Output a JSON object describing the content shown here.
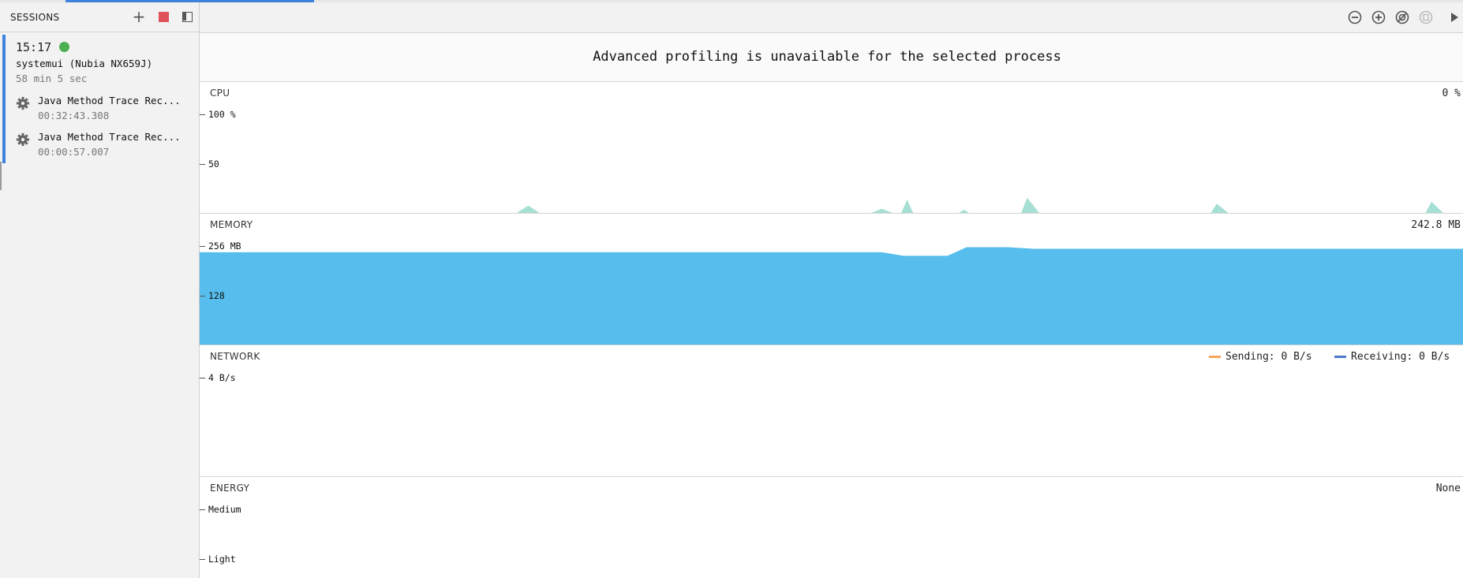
{
  "progress": {
    "fraction": 0.17
  },
  "sessions": {
    "title": "SESSIONS",
    "session": {
      "time": "15:17",
      "status_color": "#4caf50",
      "process": "systemui (Nubia NX659J)",
      "duration": "58 min 5 sec"
    },
    "traces": [
      {
        "name": "Java Method Trace Rec...",
        "time": "00:32:43.308",
        "icon": "gear-icon"
      },
      {
        "name": "Java Method Trace Rec...",
        "time": "00:00:57.007",
        "icon": "gear-icon"
      }
    ]
  },
  "toolbar": {
    "icons": [
      "zoom-out-icon",
      "zoom-in-icon",
      "reset-zoom-icon",
      "attach-to-live-icon",
      "go-live-icon"
    ]
  },
  "banner": {
    "text": "Advanced profiling is unavailable for the selected process"
  },
  "monitors": {
    "cpu": {
      "title": "CPU",
      "value": "0 %",
      "axis": [
        "100 %",
        "50"
      ],
      "color": "#a6dfd3"
    },
    "memory": {
      "title": "MEMORY",
      "value": "242.8 MB",
      "axis": [
        "256 MB",
        "128"
      ],
      "color": "#56bdec"
    },
    "network": {
      "title": "NETWORK",
      "axis": [
        "4 B/s"
      ],
      "sending": "Sending: 0 B/s",
      "receiving": "Receiving: 0 B/s",
      "sending_color": "#f7a35c",
      "receiving_color": "#4f78c8"
    },
    "energy": {
      "title": "ENERGY",
      "value": "None",
      "axis": [
        "Medium",
        "Light"
      ]
    }
  },
  "chart_data": [
    {
      "type": "area",
      "title": "CPU",
      "ylabel": "%",
      "ylim": [
        0,
        100
      ],
      "x": [
        0.25,
        0.26,
        0.27,
        0.53,
        0.54,
        0.55,
        0.555,
        0.56,
        0.565,
        0.57,
        0.6,
        0.605,
        0.61,
        0.65,
        0.655,
        0.665,
        0.8,
        0.805,
        0.815,
        0.97,
        0.975,
        0.985
      ],
      "values": [
        0,
        8,
        0,
        0,
        5,
        0,
        0,
        14,
        0,
        0,
        0,
        4,
        0,
        0,
        16,
        0,
        0,
        10,
        0,
        0,
        12,
        0
      ]
    },
    {
      "type": "area",
      "title": "MEMORY",
      "ylabel": "MB",
      "ylim": [
        0,
        256
      ],
      "x": [
        0,
        0.54,
        0.557,
        0.592,
        0.607,
        0.64,
        0.66,
        1
      ],
      "values": [
        238,
        238,
        229,
        229,
        251,
        251,
        247,
        247
      ]
    }
  ]
}
